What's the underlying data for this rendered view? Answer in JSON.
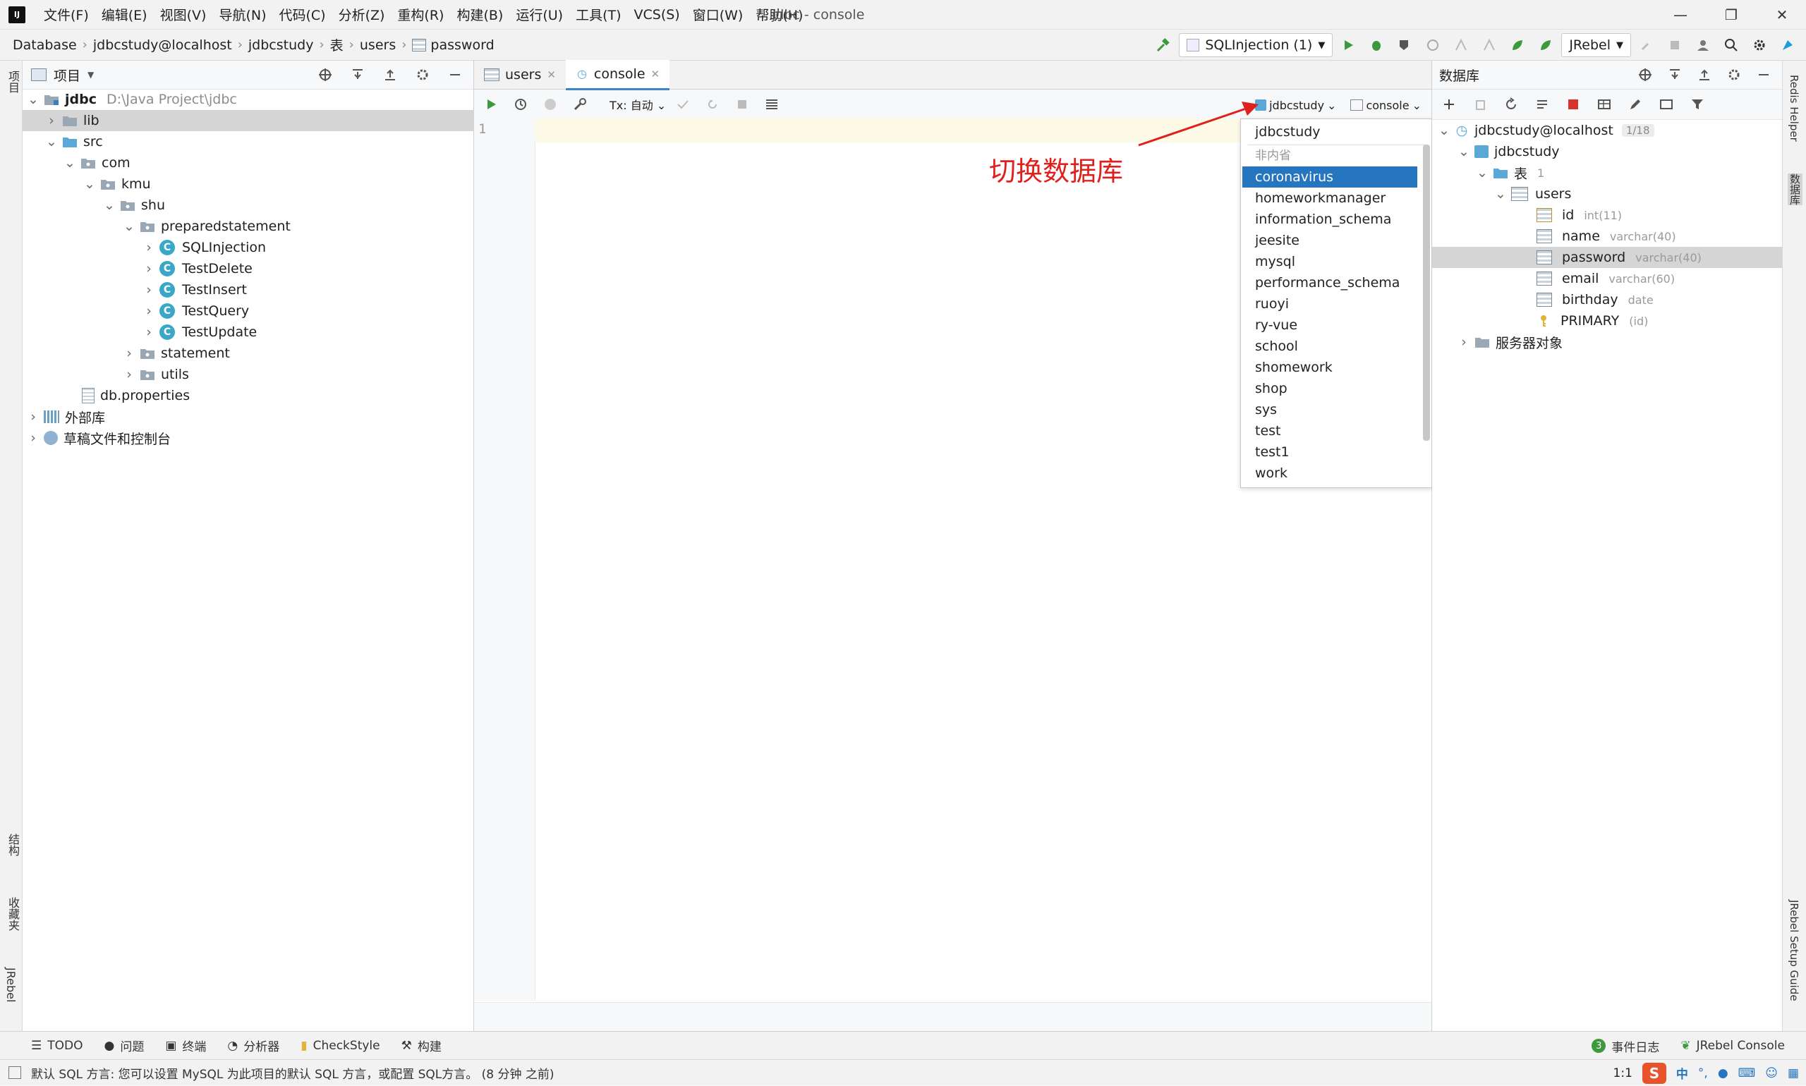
{
  "window_title": "jdbc - console",
  "menu": [
    "文件(F)",
    "编辑(E)",
    "视图(V)",
    "导航(N)",
    "代码(C)",
    "分析(Z)",
    "重构(R)",
    "构建(B)",
    "运行(U)",
    "工具(T)",
    "VCS(S)",
    "窗口(W)",
    "帮助(H)"
  ],
  "breadcrumb": [
    "Database",
    "jdbcstudy@localhost",
    "jdbcstudy",
    "表",
    "users",
    "password"
  ],
  "toolbar": {
    "run_config": "SQLInjection (1)",
    "jrebel": "JRebel"
  },
  "left_stripe": {
    "project": "项目",
    "structure": "结构",
    "favorites": "收藏夹",
    "jrebel": "JRebel"
  },
  "project_panel": {
    "title": "项目",
    "root": {
      "name": "jdbc",
      "path": "D:\\Java Project\\jdbc"
    },
    "items": {
      "lib": "lib",
      "src": "src",
      "com": "com",
      "kmu": "kmu",
      "shu": "shu",
      "preparedstatement": "preparedstatement",
      "classes": [
        "SQLInjection",
        "TestDelete",
        "TestInsert",
        "TestQuery",
        "TestUpdate"
      ],
      "statement": "statement",
      "utils": "utils",
      "dbprops": "db.properties",
      "external": "外部库",
      "scratches": "草稿文件和控制台"
    }
  },
  "editor": {
    "tabs": [
      "users",
      "console"
    ],
    "tx_label": "Tx: 自动",
    "schema_selector": "jdbcstudy",
    "session_selector": "console",
    "line_number": "1"
  },
  "annotation": "切换数据库",
  "schema_dropdown": {
    "current": "jdbcstudy",
    "section_label": "非内省",
    "schemas": [
      "coronavirus",
      "homeworkmanager",
      "information_schema",
      "jeesite",
      "mysql",
      "performance_schema",
      "ruoyi",
      "ry-vue",
      "school",
      "shomework",
      "shop",
      "sys",
      "test",
      "test1",
      "work"
    ],
    "selected": "coronavirus"
  },
  "db_panel": {
    "title": "数据库",
    "connection": "jdbcstudy@localhost",
    "connection_count": "1/18",
    "schema": "jdbcstudy",
    "tables_label": "表",
    "tables_count": "1",
    "table": "users",
    "columns": [
      {
        "name": "id",
        "type": "int(11)"
      },
      {
        "name": "name",
        "type": "varchar(40)"
      },
      {
        "name": "password",
        "type": "varchar(40)"
      },
      {
        "name": "email",
        "type": "varchar(60)"
      },
      {
        "name": "birthday",
        "type": "date"
      }
    ],
    "primary_key": {
      "name": "PRIMARY",
      "cols": "(id)"
    },
    "server_objects": "服务器对象"
  },
  "right_stripe": {
    "redis": "Redis Helper",
    "database": "数据库",
    "jrebel_guide": "JRebel Setup Guide"
  },
  "bottom_tabs": [
    "TODO",
    "问题",
    "终端",
    "分析器",
    "CheckStyle",
    "构建"
  ],
  "bottom_right": {
    "event_count": "3",
    "event_log": "事件日志",
    "jrebel_console": "JRebel Console"
  },
  "status": {
    "message": "默认 SQL 方言: 您可以设置 MySQL 为此项目的默认 SQL 方言，或配置 SQL方言。 (8 分钟 之前)",
    "position": "1:1",
    "ime": "中"
  },
  "colors": {
    "accent": "#2675bf",
    "selection_gray": "#d5d5d5",
    "annotation_red": "#e0201c",
    "run_green": "#3c9a3c"
  }
}
